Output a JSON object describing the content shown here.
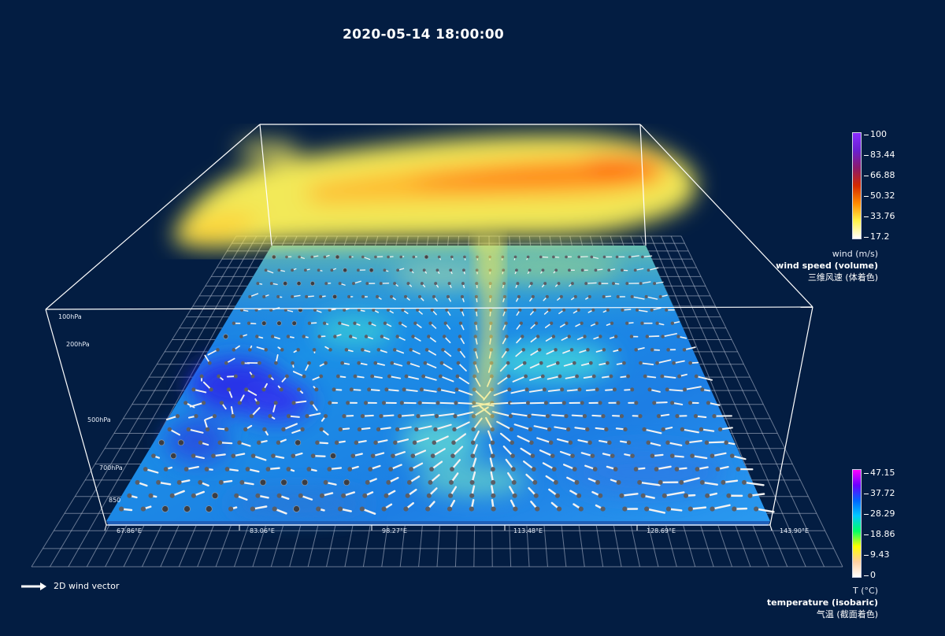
{
  "title": "2020-05-14 18:00:00",
  "wind_legend": {
    "ticks": [
      "100",
      "83.44",
      "66.88",
      "50.32",
      "33.76",
      "17.2"
    ],
    "unit": "wind (m/s)",
    "name": "wind speed (volume)",
    "name_cn": "三维风速 (体着色)",
    "colors": [
      "#8a2cff",
      "#6a1fd0",
      "#8c1a6a",
      "#d42a00",
      "#ff8a00",
      "#fff44a",
      "#ffffff"
    ]
  },
  "temp_legend": {
    "ticks": [
      "47.15",
      "37.72",
      "28.29",
      "18.86",
      "9.43",
      "0"
    ],
    "unit": "T (°C)",
    "name": "temperature (isobaric)",
    "name_cn": "气温 (截面着色)",
    "colors": [
      "#ff00ff",
      "#6a00ff",
      "#0066ff",
      "#00c8ff",
      "#00ff66",
      "#ffff00",
      "#ffd0a0",
      "#ffffff"
    ]
  },
  "pressure_levels": [
    "100hPa",
    "200hPa",
    "500hPa",
    "700hPa",
    "850"
  ],
  "longitudes": [
    "67.86°E",
    "83.06°E",
    "98.27°E",
    "113.48°E",
    "128.69°E",
    "143.90°E"
  ],
  "vector_legend": "2D wind vector"
}
